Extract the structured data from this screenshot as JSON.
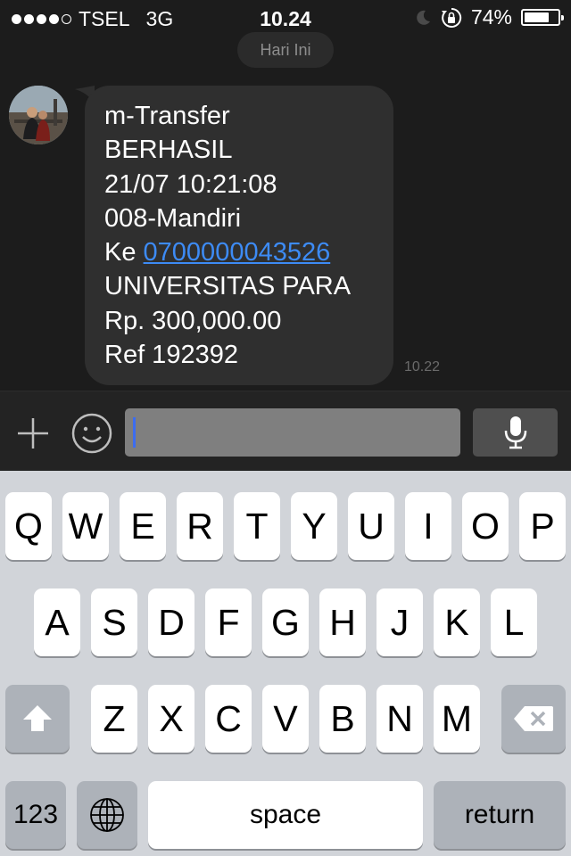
{
  "status_bar": {
    "carrier": "TSEL",
    "network": "3G",
    "time": "10.24",
    "battery_percent": "74%",
    "battery_level": 0.74,
    "signal_bars_filled": 4,
    "signal_bars_total": 5
  },
  "chat": {
    "date_label": "Hari Ini",
    "message": {
      "lines": [
        "m-Transfer",
        "BERHASIL",
        "21/07 10:21:08",
        "008-Mandiri",
        "UNIVERSITAS PARA",
        "Rp. 300,000.00",
        "Ref 192392"
      ],
      "to_prefix": "Ke",
      "account_link": "0700000043526",
      "time": "10.22"
    }
  },
  "input_bar": {
    "icons": [
      "plus-icon",
      "emoji-icon",
      "microphone-icon"
    ],
    "text": ""
  },
  "keyboard": {
    "row1": [
      "Q",
      "W",
      "E",
      "R",
      "T",
      "Y",
      "U",
      "I",
      "O",
      "P"
    ],
    "row2": [
      "A",
      "S",
      "D",
      "F",
      "G",
      "H",
      "J",
      "K",
      "L"
    ],
    "row3": [
      "Z",
      "X",
      "C",
      "V",
      "B",
      "N",
      "M"
    ],
    "numbers_label": "123",
    "space_label": "space",
    "return_label": "return",
    "icons": [
      "shift-icon",
      "delete-icon",
      "globe-icon"
    ]
  },
  "colors": {
    "background": "#1c1c1c",
    "bubble": "#2f2f2f",
    "link": "#3d8bf5",
    "caret": "#3c6cf0",
    "keyboard": "#d1d4d9"
  }
}
